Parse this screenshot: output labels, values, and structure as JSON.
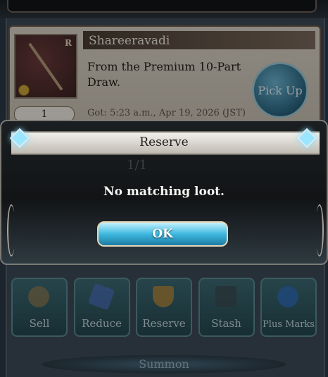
{
  "card": {
    "title": "Shareeravadi",
    "rarity_badge": "R",
    "description": "From the Premium 10-Part Draw.",
    "pick_up_label": "Pick Up",
    "quantity": "1",
    "obtained": "Got: 5:23 a.m., Apr 19, 2026 (JST)"
  },
  "dialog": {
    "title": "Reserve",
    "message": "No matching loot.",
    "ok_label": "OK",
    "page_indicator": "1/1"
  },
  "toolbar": {
    "items": [
      {
        "label": "Sell",
        "icon": "sell-icon"
      },
      {
        "label": "Reduce",
        "icon": "reduce-icon"
      },
      {
        "label": "Reserve",
        "icon": "reserve-icon"
      },
      {
        "label": "Stash",
        "icon": "stash-icon"
      },
      {
        "label": "Plus Marks",
        "icon": "plus-marks-icon"
      }
    ]
  },
  "summon_label": "Summon",
  "colors": {
    "ok_button": "#3fb9df",
    "dialog_bg": "#121416",
    "title_bar": "#f3f1ec"
  }
}
